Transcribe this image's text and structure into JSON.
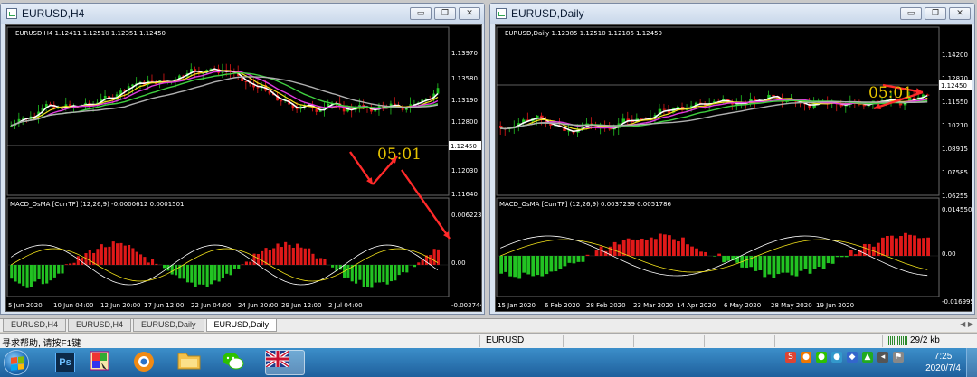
{
  "windows": [
    {
      "title": "EURUSD,H4",
      "header": "EURUSD,H4  1.12411 1.12510 1.12351 1.12450",
      "macd_header": "MACD_OsMA [CurrTF] (12,26,9) -0.0000612 0.0001501",
      "price_ticks": [
        "1.13970",
        "1.13580",
        "1.13190",
        "1.12800",
        "1.12450",
        "1.12030",
        "1.11640"
      ],
      "macd_ticks": [
        "0.0062239",
        "0.00",
        "-0.003744"
      ],
      "time_ticks": [
        "5 Jun 2020",
        "10 Jun 04:00",
        "12 Jun 20:00",
        "17 Jun 12:00",
        "22 Jun 04:00",
        "24 Jun 20:00",
        "29 Jun 12:00",
        "2 Jul 04:00"
      ],
      "current_price": "1.12450",
      "annotation": "05:01"
    },
    {
      "title": "EURUSD,Daily",
      "header": "EURUSD,Daily  1.12385 1.12510 1.12186 1.12450",
      "macd_header": "MACD_OsMA [CurrTF] (12,26,9) 0.0037239 0.0051786",
      "price_ticks": [
        "1.14200",
        "1.12870",
        "1.12450",
        "1.11550",
        "1.10210",
        "1.08915",
        "1.07585",
        "1.06255"
      ],
      "macd_ticks": [
        "0.0145509",
        "0.00",
        "-0.016995"
      ],
      "time_ticks": [
        "15 Jan 2020",
        "6 Feb 2020",
        "28 Feb 2020",
        "23 Mar 2020",
        "14 Apr 2020",
        "6 May 2020",
        "28 May 2020",
        "19 Jun 2020"
      ],
      "current_price": "1.12450",
      "annotation": "05:01"
    }
  ],
  "window_buttons": {
    "minimize": "▭",
    "restore": "❐",
    "close": "✕"
  },
  "tabs": [
    "EURUSD,H4",
    "EURUSD,H4",
    "EURUSD,Daily",
    "EURUSD,Daily"
  ],
  "active_tab": 3,
  "status": {
    "help": "寻求帮助, 请按F1键",
    "symbol": "EURUSD",
    "traffic": "29/2 kb"
  },
  "taskbar": {
    "apps": [
      "start",
      "photoshop-icon",
      "paint-icon",
      "browser-icon",
      "explorer-icon",
      "wechat-icon",
      "uk-flag-icon"
    ],
    "ps_label": "Ps",
    "clock_time": "7:25",
    "clock_date": "2020/7/4"
  },
  "colors": {
    "chart_bg": "#000000",
    "up_bar": "#22c322",
    "down_bar": "#e01919",
    "annotation": "#e6c400",
    "arrow": "#ff2a2a",
    "ma_white": "#ffffff",
    "ma_yellow": "#f2e21a",
    "ma_magenta": "#e23ae2",
    "ma_green": "#3fcf3f",
    "ma_gray": "#b0b0b0"
  }
}
